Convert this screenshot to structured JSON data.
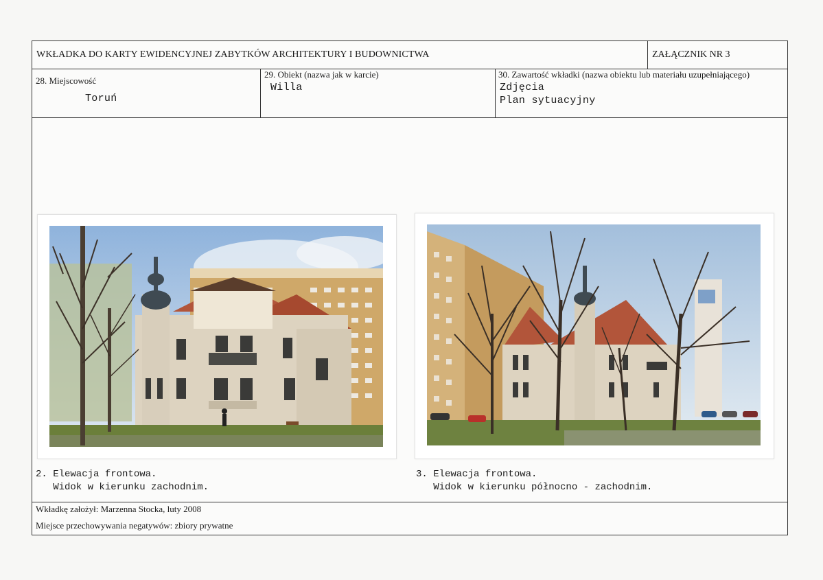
{
  "header": {
    "title": "WKŁADKA DO KARTY EWIDENCYJNEJ ZABYTKÓW ARCHITEKTURY I BUDOWNICTWA",
    "annex": "ZAŁĄCZNIK NR 3"
  },
  "fields": {
    "locality_label": "28. Miejscowość",
    "locality_value": "Toruń",
    "object_label": "29. Obiekt (nazwa jak w karcie)",
    "object_value": "Willa",
    "contents_label": "30. Zawartość wkładki (nazwa obiektu lub materiału uzupełniającego)",
    "contents_values": [
      "Zdjęcia",
      "Plan sytuacyjny"
    ]
  },
  "photos": [
    {
      "caption_line1": "2. Elewacja frontowa.",
      "caption_line2": "   Widok w kierunku zachodnim."
    },
    {
      "caption_line1": "3. Elewacja frontowa.",
      "caption_line2": "   Widok w kierunku północno - zachodnim."
    }
  ],
  "footer": {
    "author": "Wkładkę założył:  Marzenna Stocka, luty 2008",
    "storage": "Miejsce przechowywania negatywów: zbiory prywatne"
  },
  "colors": {
    "sky": "#a9c4e0",
    "grass": "#6b7f3a",
    "roof": "#b2553a",
    "facade": "#ddd3c0",
    "block": "#c9a468"
  }
}
